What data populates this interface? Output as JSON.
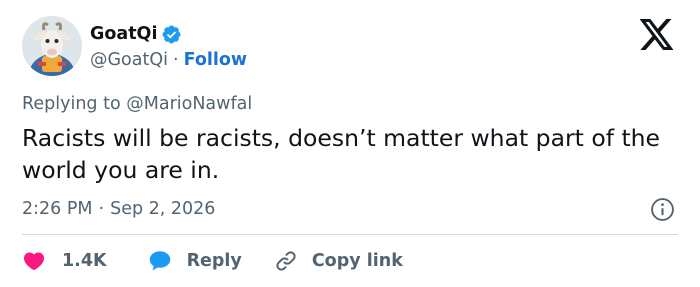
{
  "author": {
    "display_name": "GoatQi",
    "handle": "@GoatQi",
    "separator": "·",
    "follow_label": "Follow"
  },
  "reply_context": {
    "prefix": "Replying to",
    "mention": "@MarioNawfal"
  },
  "tweet": {
    "text": "Racists will be racists, doesn’t matter what part of the world you are in.",
    "time": "2:26 PM",
    "separator": "·",
    "date": "Sep 2, 2026"
  },
  "actions": {
    "like_count": "1.4K",
    "reply_label": "Reply",
    "copy_link_label": "Copy link"
  },
  "icons": {
    "verified": "verified-badge-icon",
    "platform_logo": "x-logo-icon",
    "info": "info-icon",
    "like": "heart-icon",
    "reply": "speech-bubble-icon",
    "copy": "link-icon"
  },
  "colors": {
    "accent": "#1d9bf0",
    "follow_link": "#1d72d6",
    "like": "#f91880",
    "secondary_text": "#536471",
    "primary_text": "#0f1419"
  }
}
